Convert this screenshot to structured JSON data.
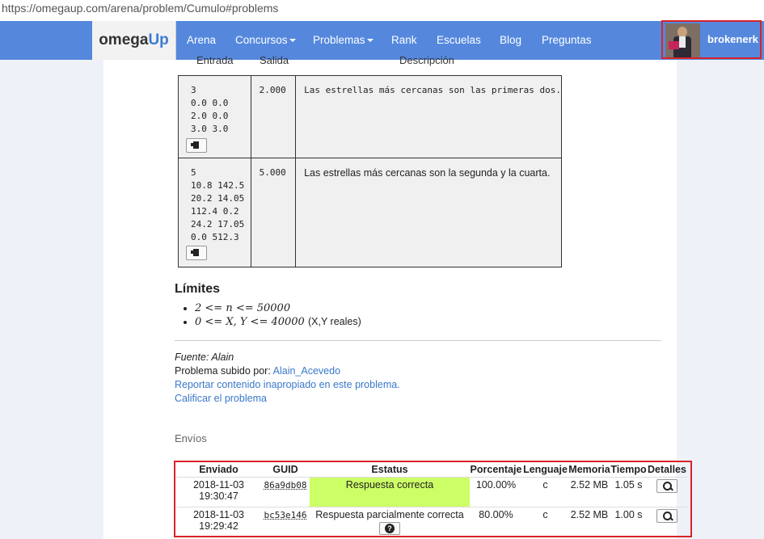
{
  "browser": {
    "url": "https://omegaup.com/arena/problem/Cumulo#problems"
  },
  "navbar": {
    "brand_part1": "omega",
    "brand_part2": "Up",
    "items": [
      {
        "label": "Arena"
      },
      {
        "label": "Concursos"
      },
      {
        "label": "Problemas"
      },
      {
        "label": "Rank"
      },
      {
        "label": "Escuelas"
      },
      {
        "label": "Blog"
      },
      {
        "label": "Preguntas"
      }
    ],
    "username": "brokenerk"
  },
  "examples": {
    "headers": [
      "Entrada",
      "Salida",
      "Descripción"
    ],
    "rows": [
      {
        "input": "3\n0.0 0.0\n2.0 0.0\n3.0 3.0",
        "output": "2.000",
        "description": "Las estrellas más cercanas son las primeras dos."
      },
      {
        "input": "5\n10.8 142.5\n20.2 14.05\n112.4 0.2\n24.2 17.05\n0.0 512.3",
        "output": "5.000",
        "description": "Las estrellas más cercanas son la segunda y la cuarta."
      }
    ]
  },
  "limits": {
    "title": "Límites",
    "items": [
      "2 <= n <= 50000",
      "0 <= X, Y <= 40000"
    ],
    "note": "(X,Y reales)"
  },
  "source": {
    "fuente": "Fuente: Alain",
    "uploaded_by_label": "Problema subido por:",
    "uploader": "Alain_Acevedo",
    "report_link": "Reportar contenido inapropiado en este problema.",
    "rate_link": "Calificar el problema"
  },
  "submissions": {
    "title": "Envíos",
    "headers": [
      "Enviado",
      "GUID",
      "Estatus",
      "Porcentaje",
      "Lenguaje",
      "Memoria",
      "Tiempo",
      "Detalles"
    ],
    "rows": [
      {
        "date": "2018-11-03",
        "time": "19:30:47",
        "guid": "86a9db08",
        "status": "Respuesta correcta",
        "percent": "100.00%",
        "lang": "c",
        "memory": "2.52 MB",
        "runtime": "1.05 s"
      },
      {
        "date": "2018-11-03",
        "time": "19:29:42",
        "guid": "bc53e146",
        "status": "Respuesta parcialmente correcta",
        "percent": "80.00%",
        "lang": "c",
        "memory": "2.52 MB",
        "runtime": "1.00 s"
      }
    ]
  },
  "colors": {
    "navbar": "#5588dd",
    "accepted": "#ccff66",
    "highlight_border": "#d8232a",
    "link": "#3a78c9"
  }
}
